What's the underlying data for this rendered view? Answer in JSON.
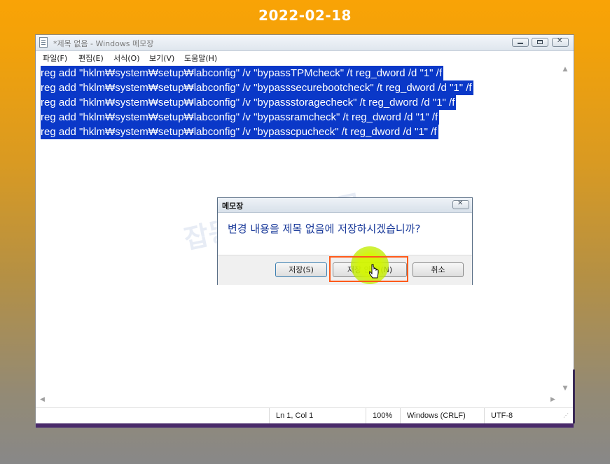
{
  "date_label": "2022-02-18",
  "window": {
    "title": "*제목 없음 - Windows 메모장",
    "menu": [
      "파일(F)",
      "편집(E)",
      "서식(O)",
      "보기(V)",
      "도움말(H)"
    ]
  },
  "editor": {
    "lines": [
      "reg add \"hklm₩system₩setup₩labconfig\" /v \"bypassTPMcheck\" /t reg_dword /d \"1\" /f",
      "reg add \"hklm₩system₩setup₩labconfig\" /v \"bypasssecurebootcheck\" /t reg_dword /d \"1\" /f",
      "reg add \"hklm₩system₩setup₩labconfig\" /v \"bypassstoragecheck\" /t reg_dword /d \"1\" /f",
      "reg add \"hklm₩system₩setup₩labconfig\" /v \"bypassramcheck\" /t reg_dword /d \"1\" /f",
      "reg add \"hklm₩system₩setup₩labconfig\" /v \"bypasscpucheck\" /t reg_dword /d \"1\" /f"
    ],
    "selection_color": "#0a38c8"
  },
  "statusbar": {
    "position": "Ln 1, Col 1",
    "zoom": "100%",
    "line_ending": "Windows (CRLF)",
    "encoding": "UTF-8"
  },
  "dialog": {
    "title": "메모장",
    "message": "변경 내용을 제목 없음에 저장하시겠습니까?",
    "save_label": "저장(S)",
    "dont_save_label": "저장 안 함(N)",
    "cancel_label": "취소"
  },
  "watermark": "잡동사니 블로그",
  "colors": {
    "highlight_box": "#ff5a1a",
    "click_marker": "#d2f500"
  }
}
